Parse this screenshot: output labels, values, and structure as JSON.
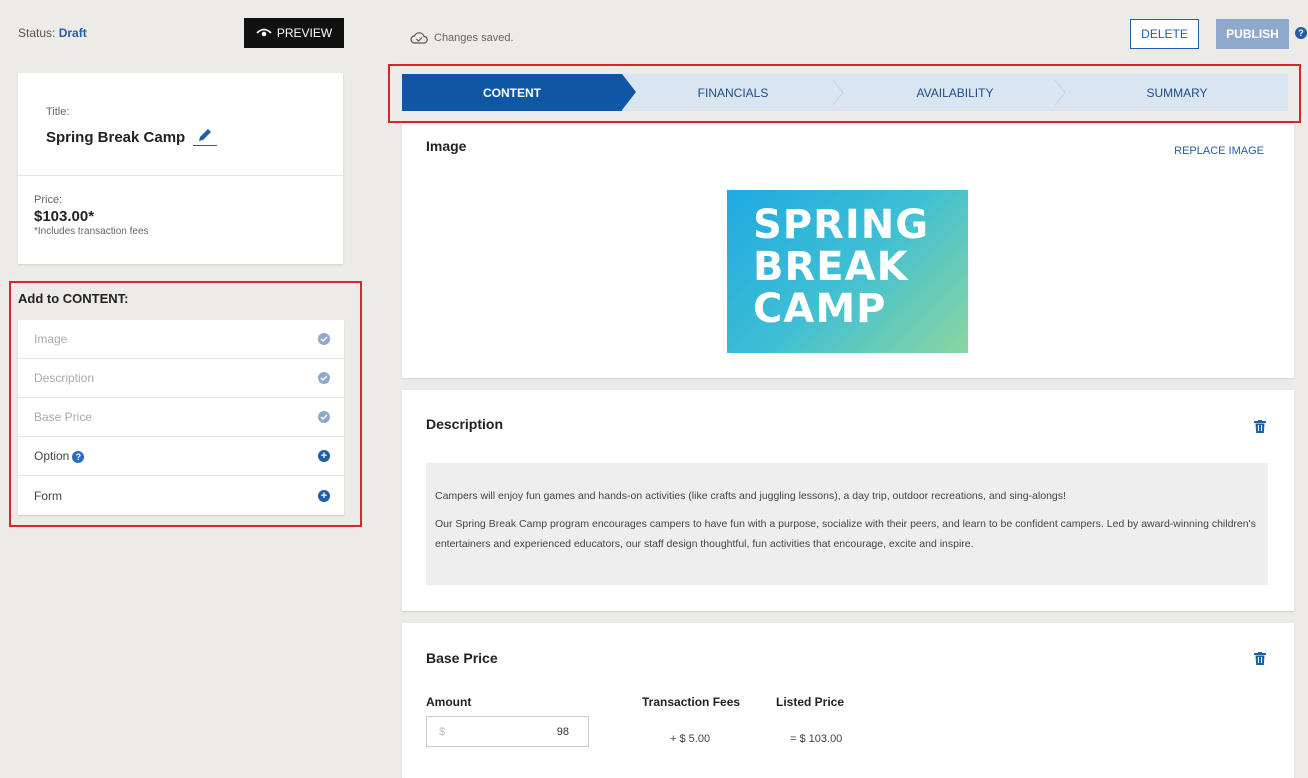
{
  "status": {
    "label": "Status:",
    "value": "Draft"
  },
  "preview_label": "PREVIEW",
  "saved_text": "Changes saved.",
  "actions": {
    "delete": "DELETE",
    "publish": "PUBLISH",
    "help": "?"
  },
  "summary": {
    "title_label": "Title:",
    "title": "Spring Break Camp",
    "price_label": "Price:",
    "price": "$103.00*",
    "price_note": "*Includes transaction fees"
  },
  "add_content": {
    "heading": "Add to CONTENT:",
    "items": [
      {
        "label": "Image",
        "state": "done"
      },
      {
        "label": "Description",
        "state": "done"
      },
      {
        "label": "Base Price",
        "state": "done"
      },
      {
        "label": "Option",
        "state": "add"
      },
      {
        "label": "Form",
        "state": "add"
      }
    ]
  },
  "steps": [
    "CONTENT",
    "FINANCIALS",
    "AVAILABILITY",
    "SUMMARY"
  ],
  "image_section": {
    "title": "Image",
    "replace": "REPLACE IMAGE",
    "hero_lines": [
      "SPRING",
      "BREAK",
      "CAMP"
    ]
  },
  "description_section": {
    "title": "Description",
    "p1": "Campers will enjoy fun games and hands-on activities (like crafts and juggling lessons), a day trip, outdoor recreations, and sing-alongs!",
    "p2": "Our Spring Break Camp program encourages campers to have fun with a purpose, socialize with their peers, and learn to be confident campers. Led by award-winning children's entertainers and experienced educators, our staff design thoughtful, fun activities that encourage, excite and inspire."
  },
  "base_price_section": {
    "title": "Base Price",
    "amount_label": "Amount",
    "currency": "$",
    "amount": "98",
    "fees_label": "Transaction Fees",
    "fees_value": "+ $ 5.00",
    "listed_label": "Listed Price",
    "listed_value": "= $ 103.00"
  },
  "colors": {
    "accent": "#0f56a5",
    "highlight": "#d9262d",
    "background": "#ecebe8"
  }
}
